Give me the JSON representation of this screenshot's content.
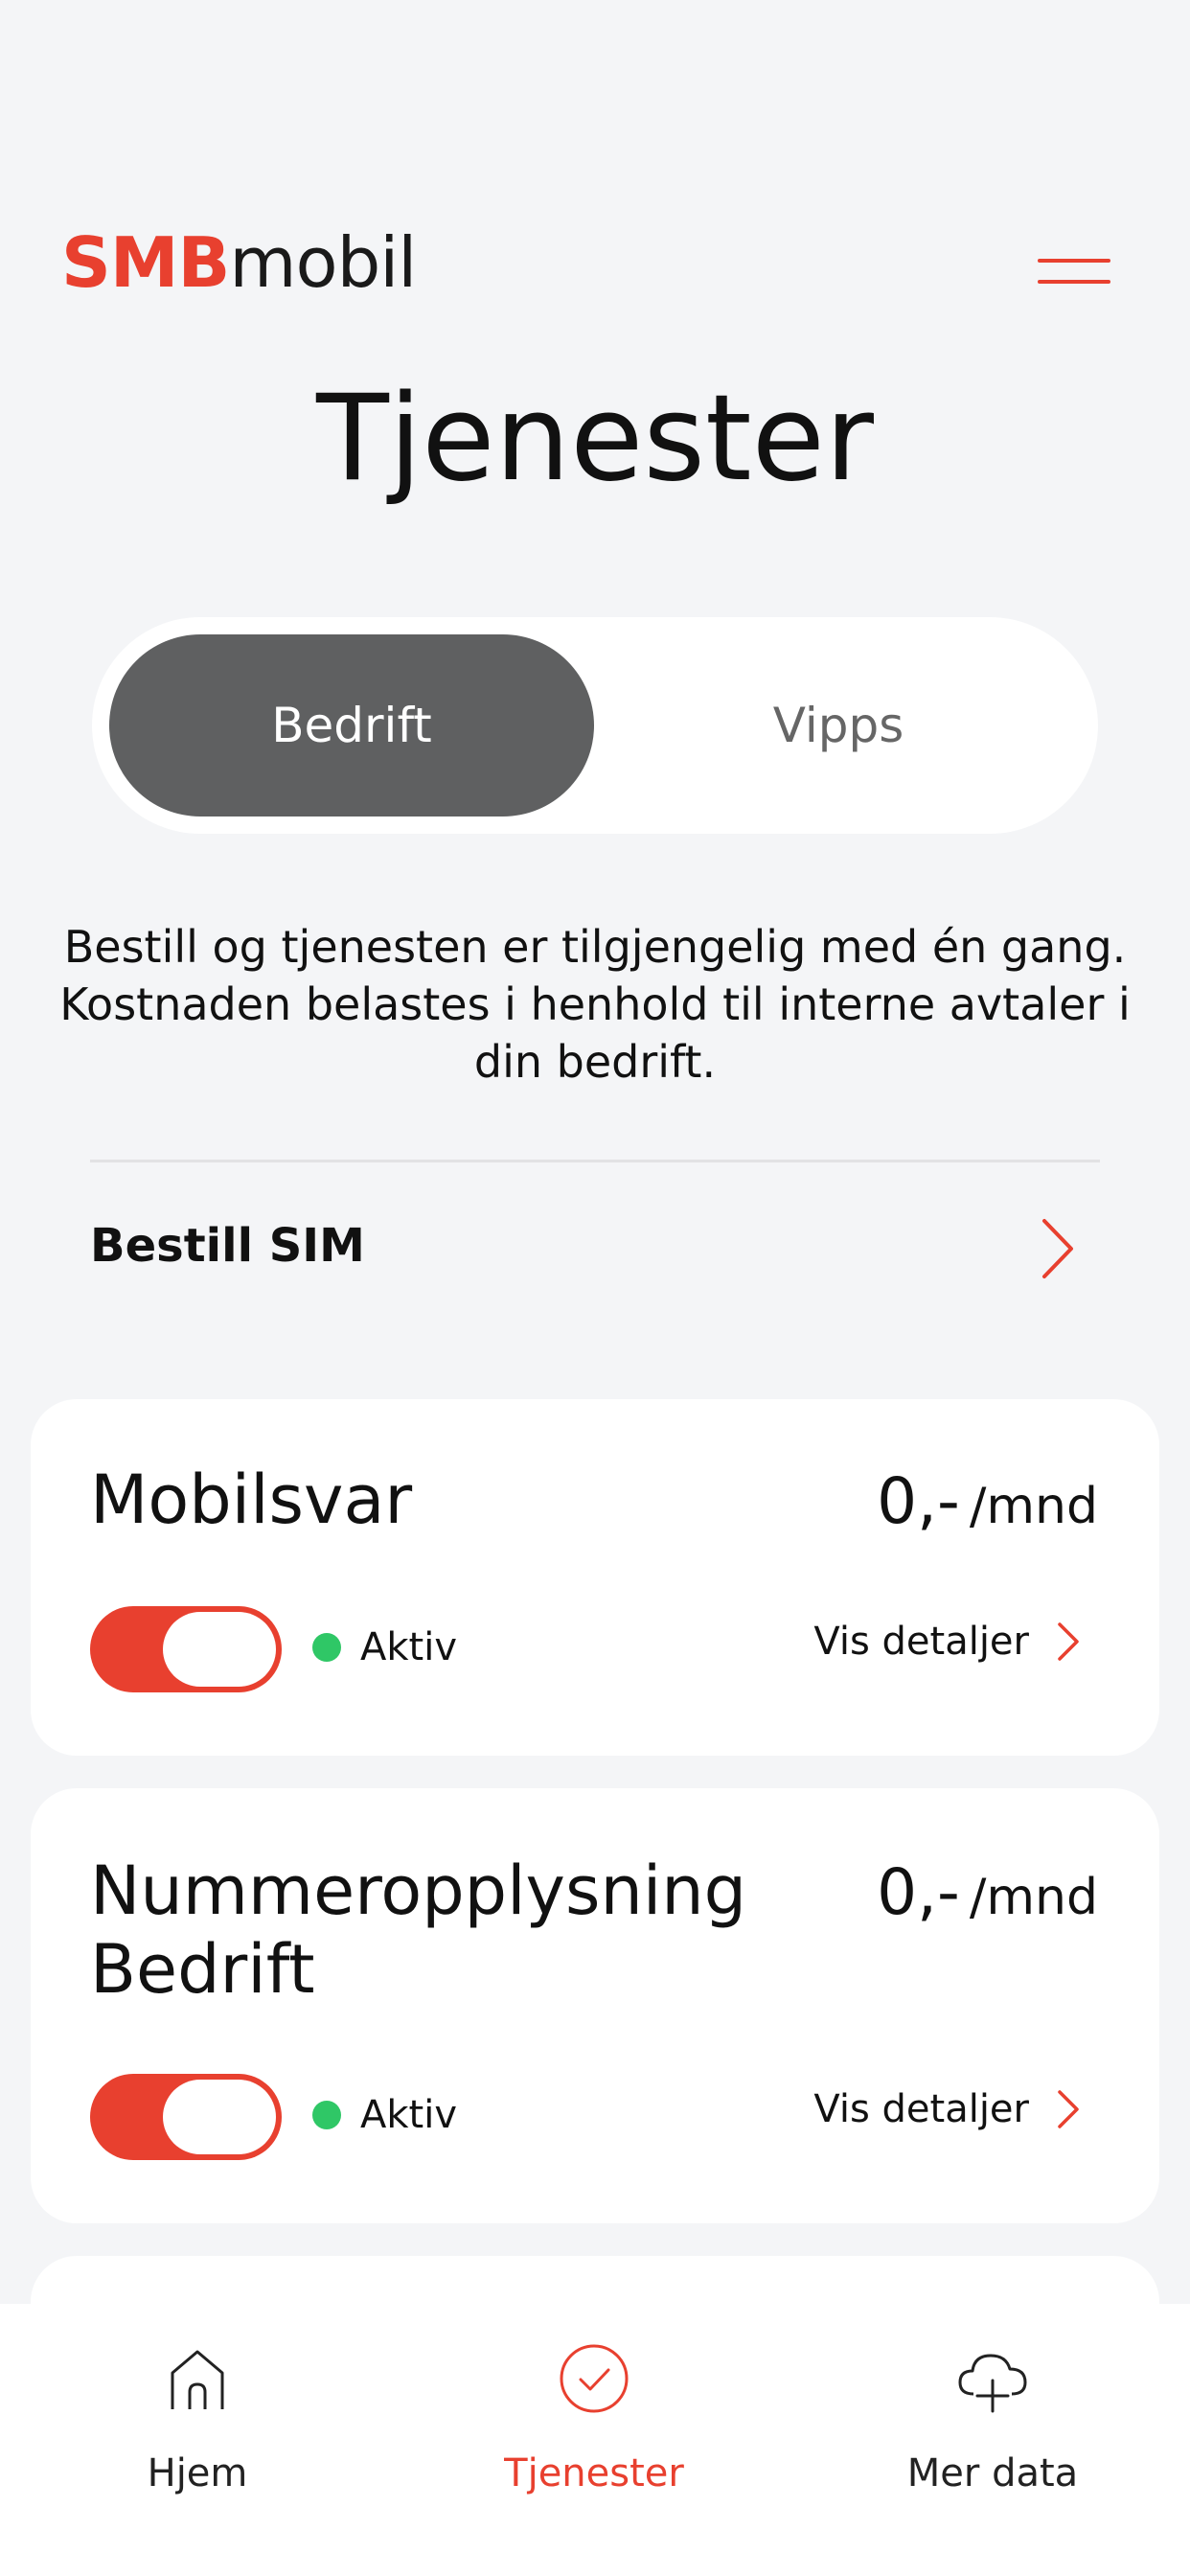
{
  "header": {
    "logo_brand": "SMB",
    "logo_suffix": "mobil"
  },
  "page_title": "Tjenester",
  "segments": [
    {
      "label": "Bedrift",
      "active": true
    },
    {
      "label": "Vipps",
      "active": false
    }
  ],
  "description": "Bestill og tjenesten er tilgjengelig med én gang. Kostnaden belastes i henhold til interne avtaler i din bedrift.",
  "order_sim": {
    "label": "Bestill SIM"
  },
  "services": [
    {
      "name": "Mobilsvar",
      "price": "0,-",
      "unit": "/mnd",
      "enabled": true,
      "status": "Aktiv",
      "details_label": "Vis detaljer"
    },
    {
      "name": "Nummeropplysning Bedrift",
      "price": "0,-",
      "unit": "/mnd",
      "enabled": true,
      "status": "Aktiv",
      "details_label": "Vis detaljer"
    }
  ],
  "tabbar": {
    "items": [
      {
        "label": "Hjem",
        "icon": "home-icon"
      },
      {
        "label": "Tjenester",
        "icon": "check-circle-icon",
        "active": true
      },
      {
        "label": "Mer data",
        "icon": "cloud-plus-icon"
      }
    ]
  },
  "colors": {
    "accent": "#e8402f",
    "segment_active": "#5f6061",
    "status_active": "#2fc766",
    "background": "#f4f5f7"
  }
}
